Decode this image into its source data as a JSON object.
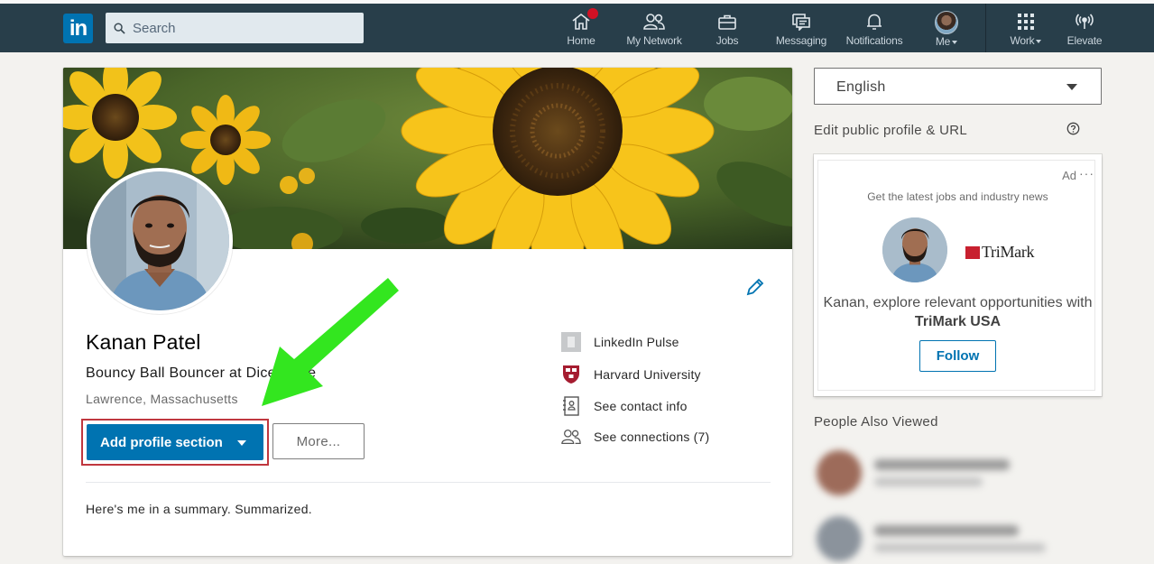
{
  "nav": {
    "search_placeholder": "Search",
    "items": [
      {
        "label": "Home",
        "icon": "home-icon",
        "has_badge": true
      },
      {
        "label": "My Network",
        "icon": "my-network-icon"
      },
      {
        "label": "Jobs",
        "icon": "jobs-icon"
      },
      {
        "label": "Messaging",
        "icon": "messaging-icon"
      },
      {
        "label": "Notifications",
        "icon": "notifications-icon"
      },
      {
        "label": "Me",
        "icon": "avatar"
      },
      {
        "label": "Work",
        "icon": "grid-icon"
      },
      {
        "label": "Elevate",
        "icon": "broadcast-icon"
      }
    ],
    "logo_text": "in"
  },
  "profile": {
    "name": "Kanan Patel",
    "headline": "Bouncy Ball Bouncer at Dice Store",
    "location": "Lawrence, Massachusetts",
    "add_section_label": "Add profile section",
    "more_label": "More...",
    "links": [
      {
        "label": "LinkedIn Pulse",
        "icon": "pulse-icon"
      },
      {
        "label": "Harvard University",
        "icon": "harvard-shield-icon"
      },
      {
        "label": "See contact info",
        "icon": "contact-card-icon"
      },
      {
        "label": "See connections (7)",
        "icon": "connections-icon"
      }
    ],
    "summary": "Here's me in a summary. Summarized."
  },
  "rail": {
    "language": "English",
    "edit_public_profile": "Edit public profile & URL",
    "ad": {
      "label": "Ad",
      "dots": "···",
      "tagline": "Get the latest jobs and industry news",
      "brand": "TriMark",
      "message_prefix": "Kanan, explore relevant opportunities with",
      "message_company": "TriMark USA",
      "follow_label": "Follow"
    },
    "people_also_viewed": "People Also Viewed"
  },
  "colors": {
    "nav_bg": "#283e4a",
    "brand_blue": "#0073b1",
    "highlight_red": "#c0373f",
    "arrow_green": "#33e61f",
    "badge_red": "#d11124"
  }
}
